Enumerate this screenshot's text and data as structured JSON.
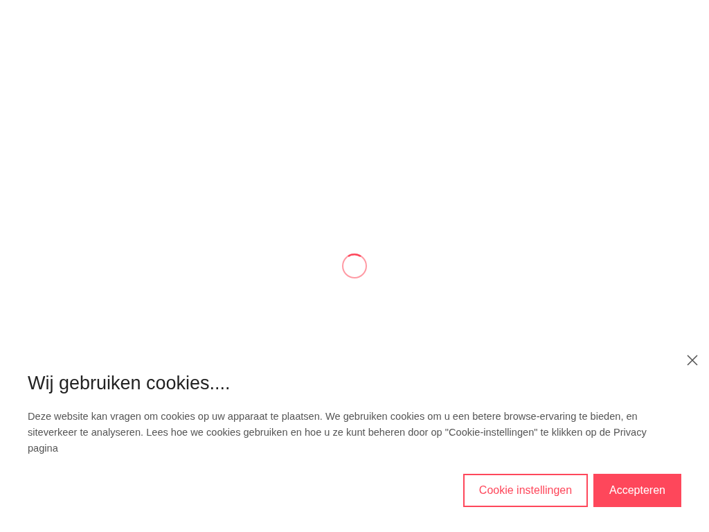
{
  "loading": {
    "spinner": true
  },
  "cookie_banner": {
    "title": "Wij gebruiken cookies....",
    "text": "Deze website kan vragen om cookies op uw apparaat te plaatsen. We gebruiken cookies om u een betere browse-ervaring te bieden, en siteverkeer te analyseren. Lees hoe we cookies gebruiken en hoe u ze kunt beheren door op \"Cookie-instellingen\" te klikken op de Privacy pagina",
    "buttons": [
      {
        "label": "Cookie instellingen",
        "kind": "outline"
      },
      {
        "label": "Accepteren",
        "kind": "filled"
      }
    ]
  }
}
